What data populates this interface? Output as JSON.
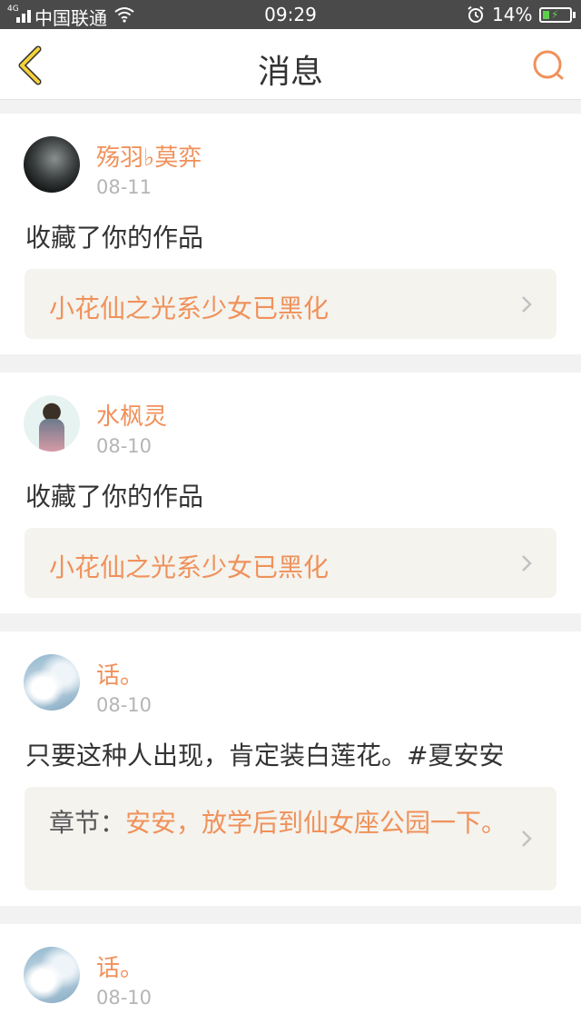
{
  "status_bar": {
    "network": "4G",
    "carrier": "中国联通",
    "time": "09:29",
    "battery_percent": "14%"
  },
  "header": {
    "title": "消息"
  },
  "messages": [
    {
      "user": "殇羽♭莫弈",
      "date": "08-11",
      "text": "收藏了你的作品",
      "work_title": "小花仙之光系少女已黑化"
    },
    {
      "user": "水枫灵",
      "date": "08-10",
      "text": "收藏了你的作品",
      "work_title": "小花仙之光系少女已黑化"
    },
    {
      "user": "话。",
      "date": "08-10",
      "text": "只要这种人出现，肯定装白莲花。#夏安安",
      "chapter_prefix": "章节：",
      "chapter_title": "安安，放学后到仙女座公园一下。"
    },
    {
      "user": "话。",
      "date": "08-10"
    }
  ],
  "colors": {
    "accent": "#f0915a",
    "back_icon": "#f5d23a",
    "status_bar_bg": "#4a4a4a",
    "link_bg": "#f4f3ee"
  }
}
